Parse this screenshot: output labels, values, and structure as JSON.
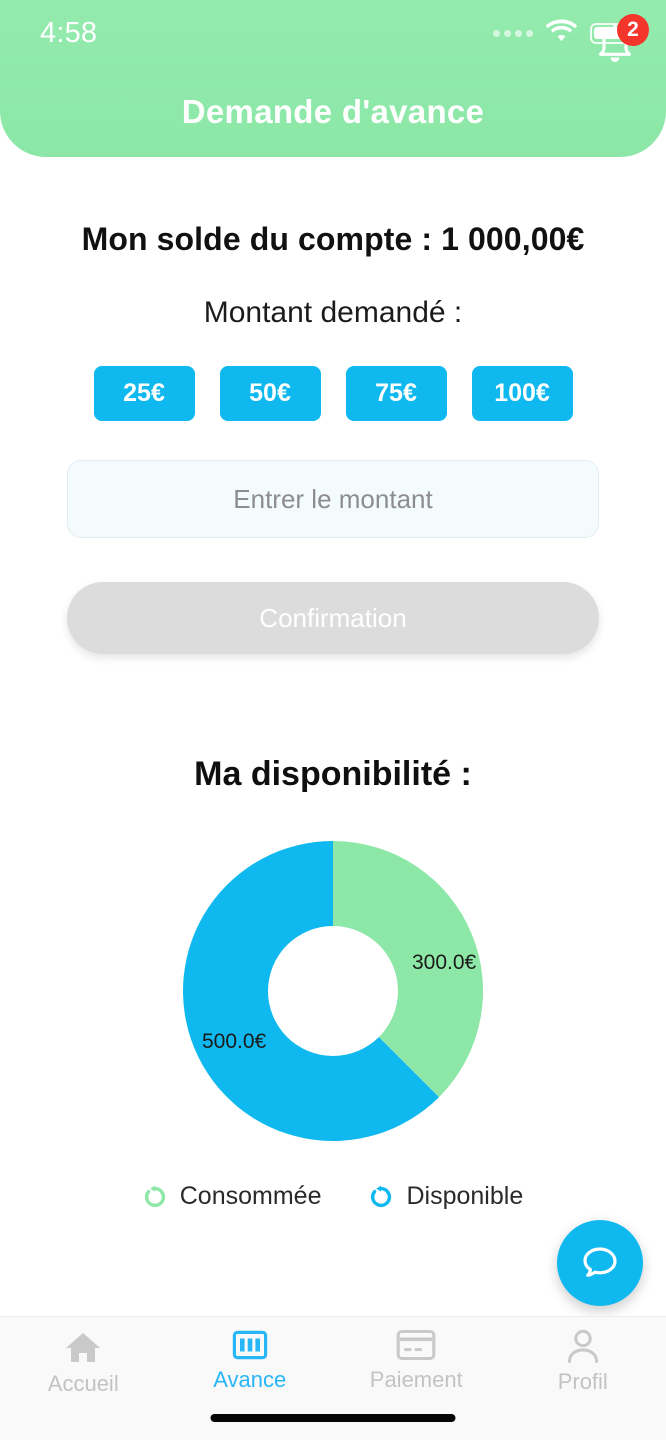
{
  "status_bar": {
    "time": "4:58",
    "signal_icon": "signal-dots-icon",
    "wifi_icon": "wifi-icon",
    "battery_icon": "battery-icon"
  },
  "header": {
    "title": "Demande d'avance",
    "bell_icon": "bell-icon",
    "notification_count": "2",
    "background_color": "#8DE8A8",
    "badge_color": "#F4352B"
  },
  "main": {
    "balance_text": "Mon solde du compte : 1 000,00€",
    "amount_label": "Montant demandé :",
    "quick_amounts": [
      {
        "label": "25€"
      },
      {
        "label": "50€"
      },
      {
        "label": "75€"
      },
      {
        "label": "100€"
      }
    ],
    "amount_input": {
      "placeholder": "Entrer le montant",
      "value": ""
    },
    "confirm_label": "Confirmation",
    "chart_title": "Ma disponibilité :",
    "accent_color": "#0FB9EF"
  },
  "chart_data": {
    "type": "pie",
    "title": "Ma disponibilité :",
    "donut": true,
    "start_angle_deg": 0,
    "direction": "clockwise",
    "total": 800,
    "labels": [
      "Consommée",
      "Disponible"
    ],
    "values": [
      300,
      500
    ],
    "value_labels": [
      "300.0€",
      "500.0€"
    ],
    "colors": [
      "#8DE8A8",
      "#0FB9EF"
    ],
    "percentages": [
      37.5,
      62.5
    ],
    "legend_position": "bottom",
    "legend": [
      {
        "label": "Consommée",
        "color": "#8DE8A8",
        "marker": "ring-arrow-icon"
      },
      {
        "label": "Disponible",
        "color": "#0FB9EF",
        "marker": "ring-arrow-icon"
      }
    ]
  },
  "fab": {
    "icon": "chat-bubble-icon",
    "color": "#0FB9EF"
  },
  "bottom_nav": {
    "active_index": 1,
    "items": [
      {
        "label": "Accueil",
        "icon": "home-icon"
      },
      {
        "label": "Avance",
        "icon": "banknote-icon"
      },
      {
        "label": "Paiement",
        "icon": "credit-card-icon"
      },
      {
        "label": "Profil",
        "icon": "person-icon"
      }
    ]
  }
}
